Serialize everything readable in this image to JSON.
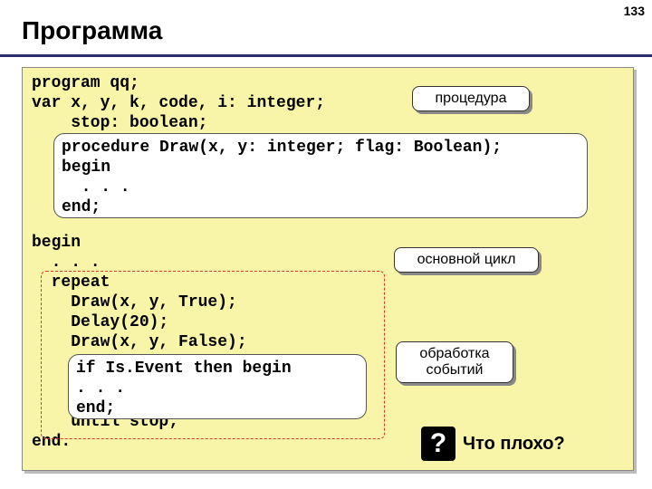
{
  "page_number": "133",
  "title": "Программа",
  "code_plain": "program qq;\nvar x, y, k, code, i: integer;\n    stop: boolean;\n\n\n\n\n\nbegin\n  . . .\n  repeat\n    Draw(x, y, True);\n    Delay(20);\n    Draw(x, y, False);\n\n\n\n    until stop;\nend.",
  "proc_code": "procedure Draw(x, y: integer; flag: Boolean);\nbegin\n  . . .\nend;",
  "event_code": "if Is.Event then begin\n. . .\nend;",
  "callouts": {
    "procedure": "процедура",
    "main_loop": "основной цикл",
    "events": "обработка\nсобытий"
  },
  "question": {
    "mark": "?",
    "text": "Что плохо?"
  }
}
